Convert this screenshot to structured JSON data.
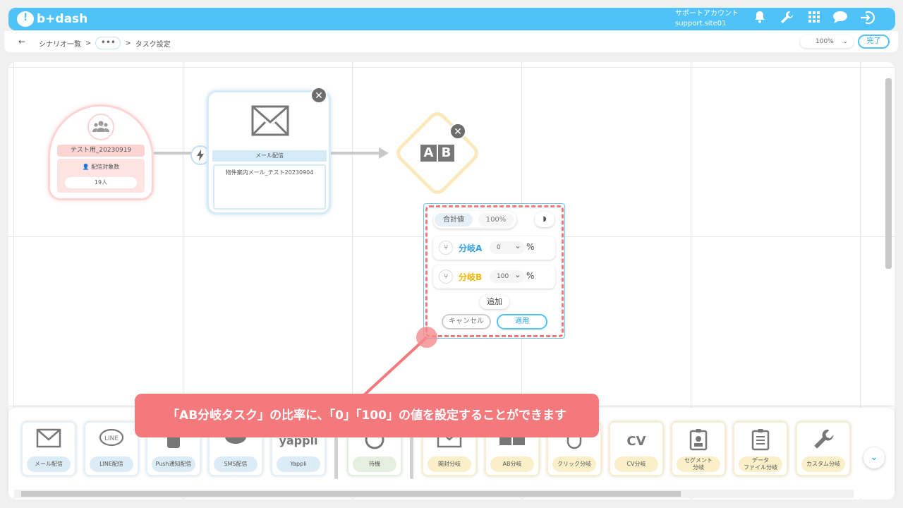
{
  "header": {
    "logo_text": "b+dash",
    "account_name": "サポートアカウント",
    "account_site": "support.site01",
    "icons": [
      "bell-icon",
      "wrench-icon",
      "grid-icon",
      "chat-icon",
      "logout-icon"
    ]
  },
  "subbar": {
    "back": "←",
    "breadcrumb_root": "シナリオ一覧",
    "breadcrumb_sep": ">",
    "breadcrumb_more": "•••",
    "breadcrumb_current": "タスク設定",
    "zoom": "100%",
    "done": "完了"
  },
  "start_node": {
    "name": "テスト用_20230919",
    "label": "配信対象数",
    "count": "19人"
  },
  "mail_node": {
    "label": "メール配信",
    "content": "物件案内メール_テスト20230904"
  },
  "ab_node": {
    "a": "A",
    "b": "B"
  },
  "popup": {
    "total_label": "合計値",
    "total_value": "100%",
    "branches": [
      {
        "name": "分岐A",
        "value": "0",
        "unit": "%",
        "color": "#2f9de0"
      },
      {
        "name": "分岐B",
        "value": "100",
        "unit": "%",
        "color": "#f0b400"
      }
    ],
    "add": "追加",
    "cancel": "キャンセル",
    "apply": "適用"
  },
  "callout": "「AB分岐タスク」の比率に、「0」「100」の値を設定することができます",
  "palette": {
    "tiles": [
      {
        "label": "メール配信",
        "icon": "mail-icon"
      },
      {
        "label": "LINE配信",
        "icon": "line-icon"
      },
      {
        "label": "Push通知配信",
        "icon": "phone-icon"
      },
      {
        "label": "SMS配信",
        "icon": "sms-icon"
      },
      {
        "label": "Yappli",
        "icon": "yappli-logo",
        "icon_text": "yappli"
      },
      {
        "label": "待機",
        "icon": "clock-icon"
      },
      {
        "label": "開封分岐",
        "icon": "mail-open-icon"
      },
      {
        "label": "AB分岐",
        "icon": "ab-icon"
      },
      {
        "label": "クリック分岐",
        "icon": "mouse-icon"
      },
      {
        "label": "CV分岐",
        "icon": "cv-icon",
        "icon_text": "CV"
      },
      {
        "label": "セグメント\n分岐",
        "icon": "id-card-icon"
      },
      {
        "label": "データ\nファイル分岐",
        "icon": "document-icon"
      },
      {
        "label": "カスタム分岐",
        "icon": "wrench-icon"
      }
    ]
  },
  "colors": {
    "accent": "#4fc3f7",
    "callout": "#f4797c",
    "branch_a": "#2f9de0",
    "branch_b": "#f0b400"
  }
}
